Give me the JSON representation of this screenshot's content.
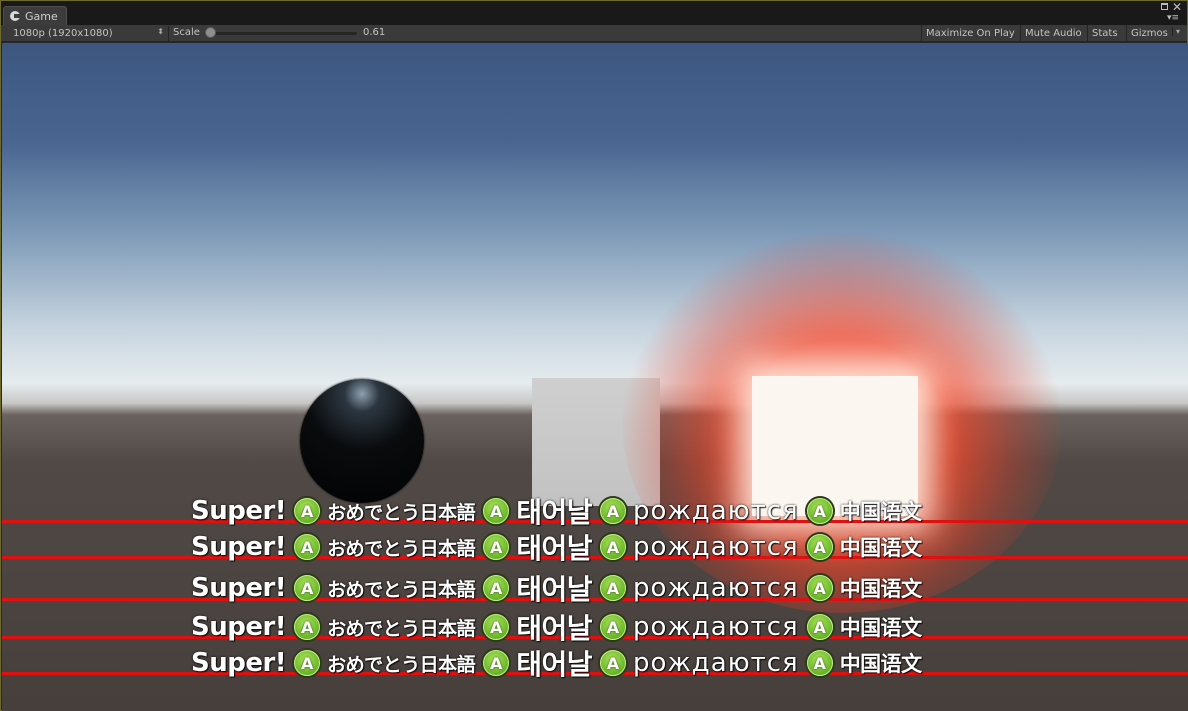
{
  "tab": {
    "label": "Game"
  },
  "toolbar": {
    "resolution": "1080p (1920x1080)",
    "scale_label": "Scale",
    "scale_value": "0.61",
    "scale_fraction": 0.03,
    "maximize_on_play": "Maximize On Play",
    "mute_audio": "Mute Audio",
    "stats": "Stats",
    "gizmos": "Gizmos"
  },
  "icons": {
    "tab": "unity-logo-icon",
    "maximize": "maximize-icon",
    "close": "close-icon",
    "menu": "menu-icon",
    "controller_button": "a-button-icon"
  },
  "colors": {
    "guide_line": "#e01010",
    "button_green": "#6ab528",
    "sky_top": "#3c5680",
    "ground": "#463f3b"
  },
  "scene": {
    "button_letter": "A",
    "rows": [
      {
        "segments": [
          "Super!",
          "おめでとう日本語",
          "태어날",
          "рождаются",
          "中国语文"
        ]
      },
      {
        "segments": [
          "Super!",
          "おめでとう日本語",
          "태어날",
          "рождаются",
          "中国语文"
        ]
      },
      {
        "segments": [
          "Super!",
          "おめでとう日本語",
          "태어날",
          "рождаются",
          "中国语文"
        ]
      },
      {
        "segments": [
          "Super!",
          "おめでとう日本語",
          "태어날",
          "рождаются",
          "中国语文"
        ]
      },
      {
        "segments": [
          "Super!",
          "おめでとう日本語",
          "태어날",
          "рождаются",
          "中国语文"
        ]
      }
    ]
  }
}
